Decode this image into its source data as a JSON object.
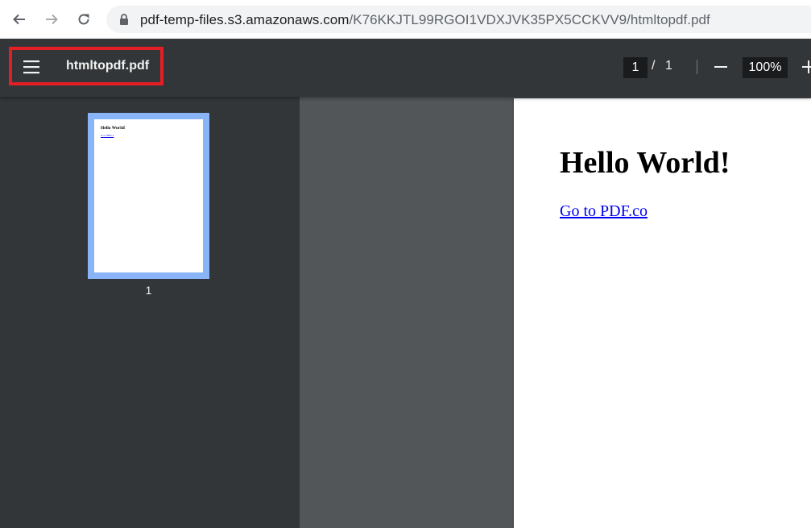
{
  "browser": {
    "url_host": "pdf-temp-files.s3.amazonaws.com",
    "url_path": "/K76KKJTL99RGOI1VDXJVK35PX5CCKVV9/htmltopdf.pdf",
    "icons": {
      "back": "arrow-left-icon",
      "forward": "arrow-right-icon",
      "reload": "reload-icon",
      "secure": "lock-icon"
    }
  },
  "toolbar": {
    "title": "htmltopdf.pdf",
    "current_page": "1",
    "page_separator": "/",
    "total_pages": "1",
    "zoom": "100%",
    "highlight_color": "#e31e24"
  },
  "sidebar": {
    "thumbnails": [
      {
        "heading": "Hello World!",
        "link": "Go to PDF.co",
        "label": "1"
      }
    ],
    "selected_color": "#8ab4f8"
  },
  "document": {
    "heading": "Hello World!",
    "link_text": "Go to PDF.co"
  }
}
